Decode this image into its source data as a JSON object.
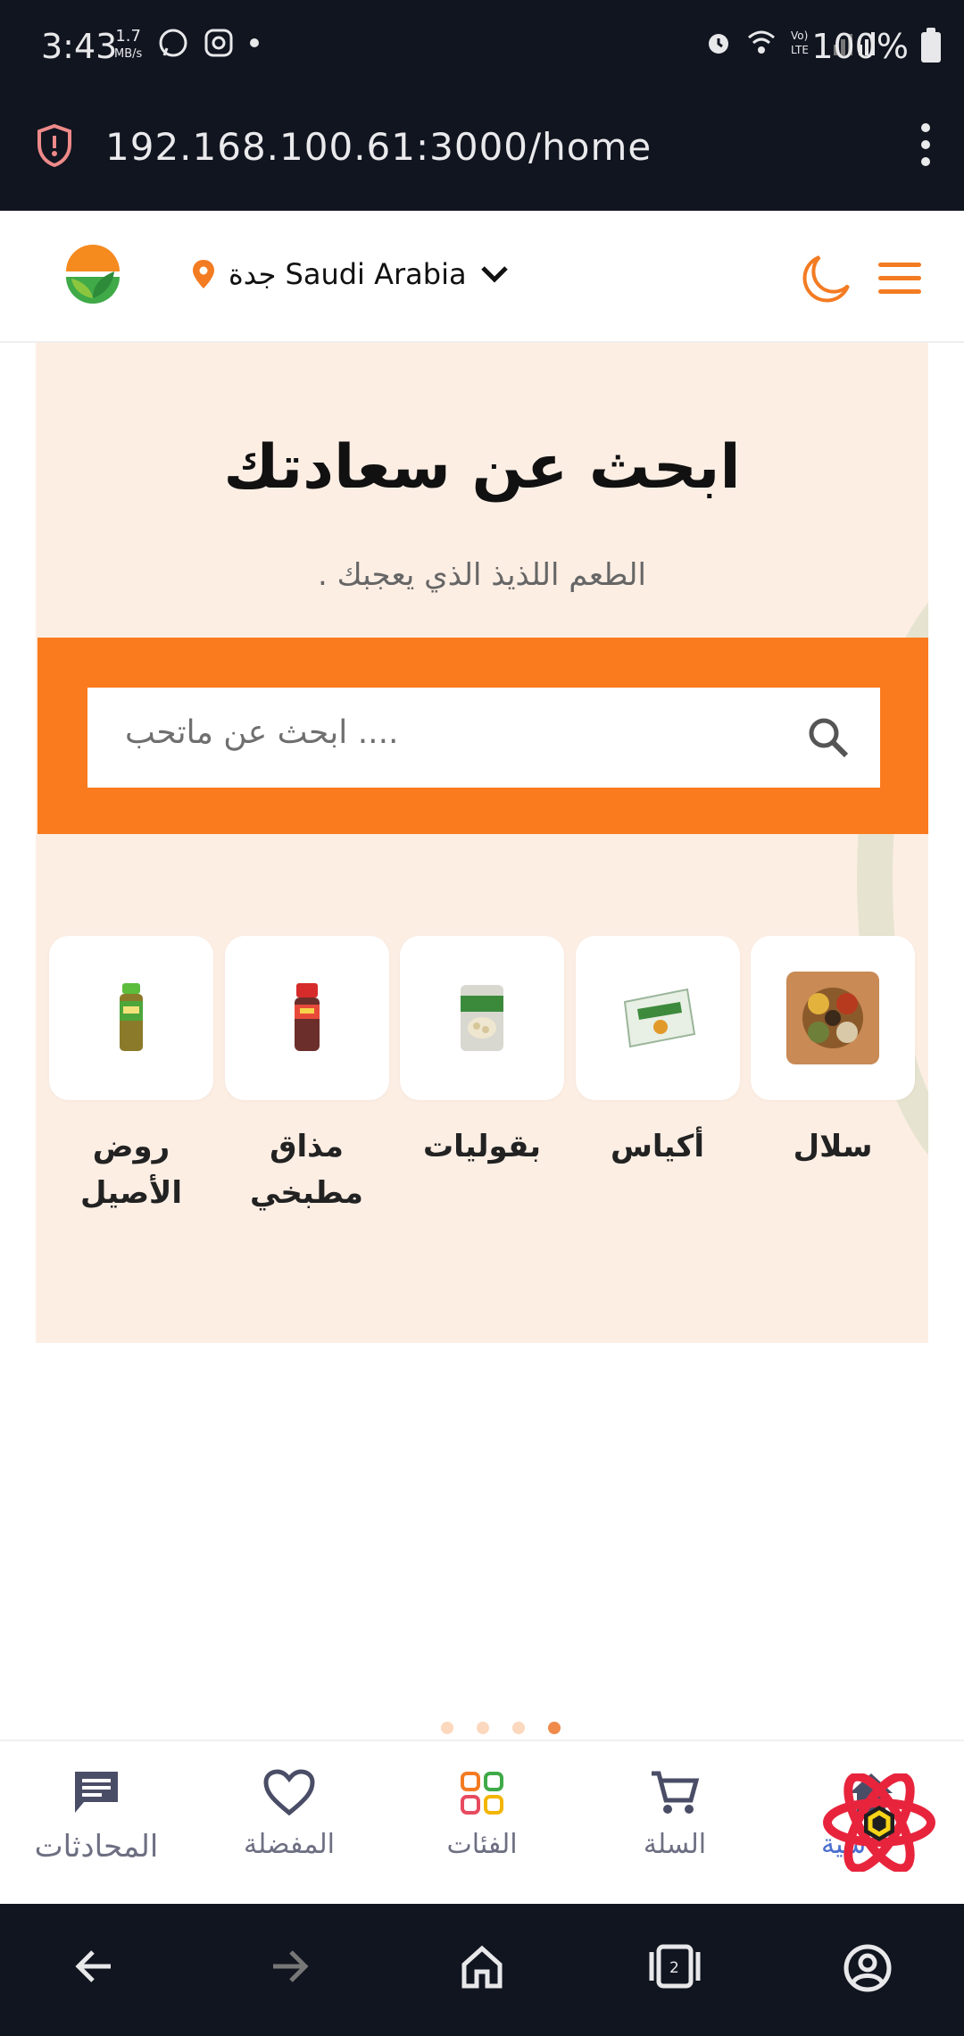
{
  "status_bar": {
    "time": "3:43",
    "speed_value": "1.7",
    "speed_unit": "MB/s",
    "battery": "100%"
  },
  "browser": {
    "url": "192.168.100.61:3000/home"
  },
  "header": {
    "location": "جدة Saudi Arabia"
  },
  "hero": {
    "title": "ابحث عن سعادتك",
    "subtitle": ". الطعم اللذيذ الذي يعجبك",
    "search_placeholder": "ابحث عن ماتحب ...."
  },
  "categories": [
    {
      "label": "سلال",
      "icon": "spices-basket-image"
    },
    {
      "label": "أكياس",
      "icon": "bag-image"
    },
    {
      "label": "بقوليات",
      "icon": "can-image"
    },
    {
      "label": "مذاق مطبخي",
      "icon": "spice-jar-image"
    },
    {
      "label": "روض الأصيل",
      "icon": "green-bottle-image"
    }
  ],
  "carousel": {
    "total": 4,
    "active": 4
  },
  "bottom_nav": {
    "chats": "المحادثات",
    "favorites": "المفضلة",
    "categories": "الفئات",
    "cart": "السلة",
    "home": "سية"
  },
  "colors": {
    "accent": "#fa7a1e",
    "hero_bg": "#fdeee4",
    "dark_bar": "#111520"
  }
}
